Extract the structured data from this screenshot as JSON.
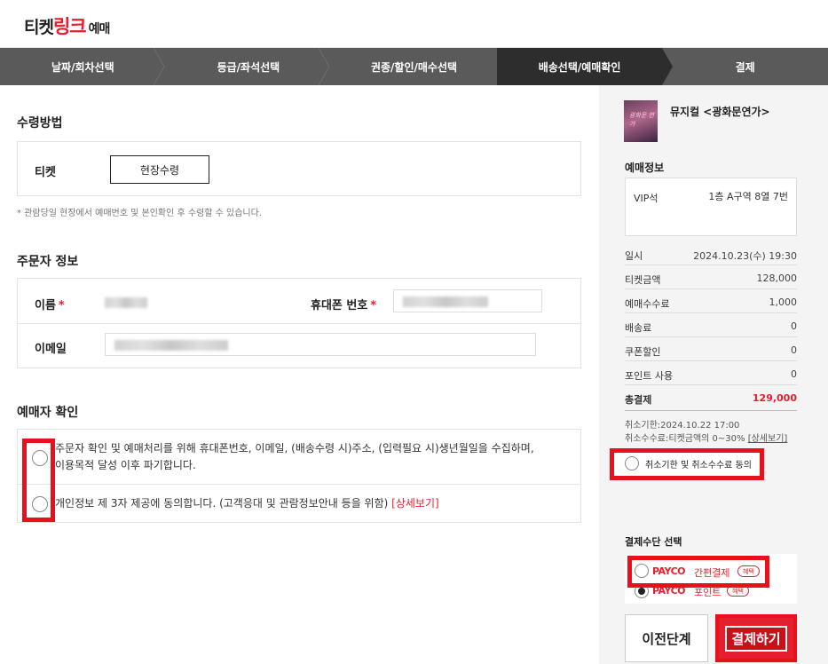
{
  "logo": {
    "part1": "티켓",
    "part2": "링크",
    "part3": "예매"
  },
  "steps": [
    {
      "label": "날짜/회차선택"
    },
    {
      "label": "등급/좌석선택"
    },
    {
      "label": "권종/할인/매수선택"
    },
    {
      "label": "배송선택/예매확인"
    },
    {
      "label": "결제"
    }
  ],
  "receive": {
    "title": "수령방법",
    "ticket_label": "티켓",
    "method_button": "현장수령",
    "note": "* 관람당일 현장에서 예매번호 및 본인확인 후 수령할 수 있습니다."
  },
  "orderer": {
    "title": "주문자 정보",
    "name_label": "이름",
    "phone_label": "휴대폰 번호",
    "email_label": "이메일",
    "required_mark": "*"
  },
  "confirm": {
    "title": "예매자 확인",
    "agree1": "주문자 확인 및 예매처리를 위해 휴대폰번호, 이메일, (배송수령 시)주소, (입력필요 시)생년월일을 수집하며,",
    "agree1b": "이용목적 달성 이후 파기합니다.",
    "agree2": "개인정보 제 3자 제공에 동의합니다. (고객응대 및 관람정보안내 등을 위함)",
    "agree2_link": "[상세보기]"
  },
  "summary": {
    "show_title": "뮤지컬 <광화문연가>",
    "poster_text": "광화문 연가",
    "booking_info_title": "예매정보",
    "seat_grade": "VIP석",
    "seat_value": "1층 A구역 8열 7번",
    "rows": [
      {
        "label": "일시",
        "value": "2024.10.23(수) 19:30"
      },
      {
        "label": "티켓금액",
        "value": "128,000"
      },
      {
        "label": "예매수수료",
        "value": "1,000"
      },
      {
        "label": "배송료",
        "value": "0"
      },
      {
        "label": "쿠폰할인",
        "value": "0"
      },
      {
        "label": "포인트 사용",
        "value": "0"
      }
    ],
    "total_label": "총결제",
    "total_value": "129,000",
    "cancel_deadline": "취소기한:2024.10.22 17:00",
    "cancel_fee": "취소수수료:티켓금액의 0~30%",
    "cancel_fee_link": "[상세보기]",
    "cancel_agree": "취소기한 및 취소수수료 동의"
  },
  "payment": {
    "title": "결제수단 선택",
    "option1_brand": "PAYCO",
    "option1_label": "간편결제",
    "option1_badge": "혜택",
    "option2_brand": "PAYCO",
    "option2_label": "포인트",
    "option2_badge": "혜택",
    "prev_button": "이전단계",
    "pay_button": "결제하기"
  },
  "colors": {
    "accent": "#e5202e",
    "highlight": "#e8101b",
    "step_bg": "#5a5a5a",
    "step_active": "#2d2d2d"
  }
}
